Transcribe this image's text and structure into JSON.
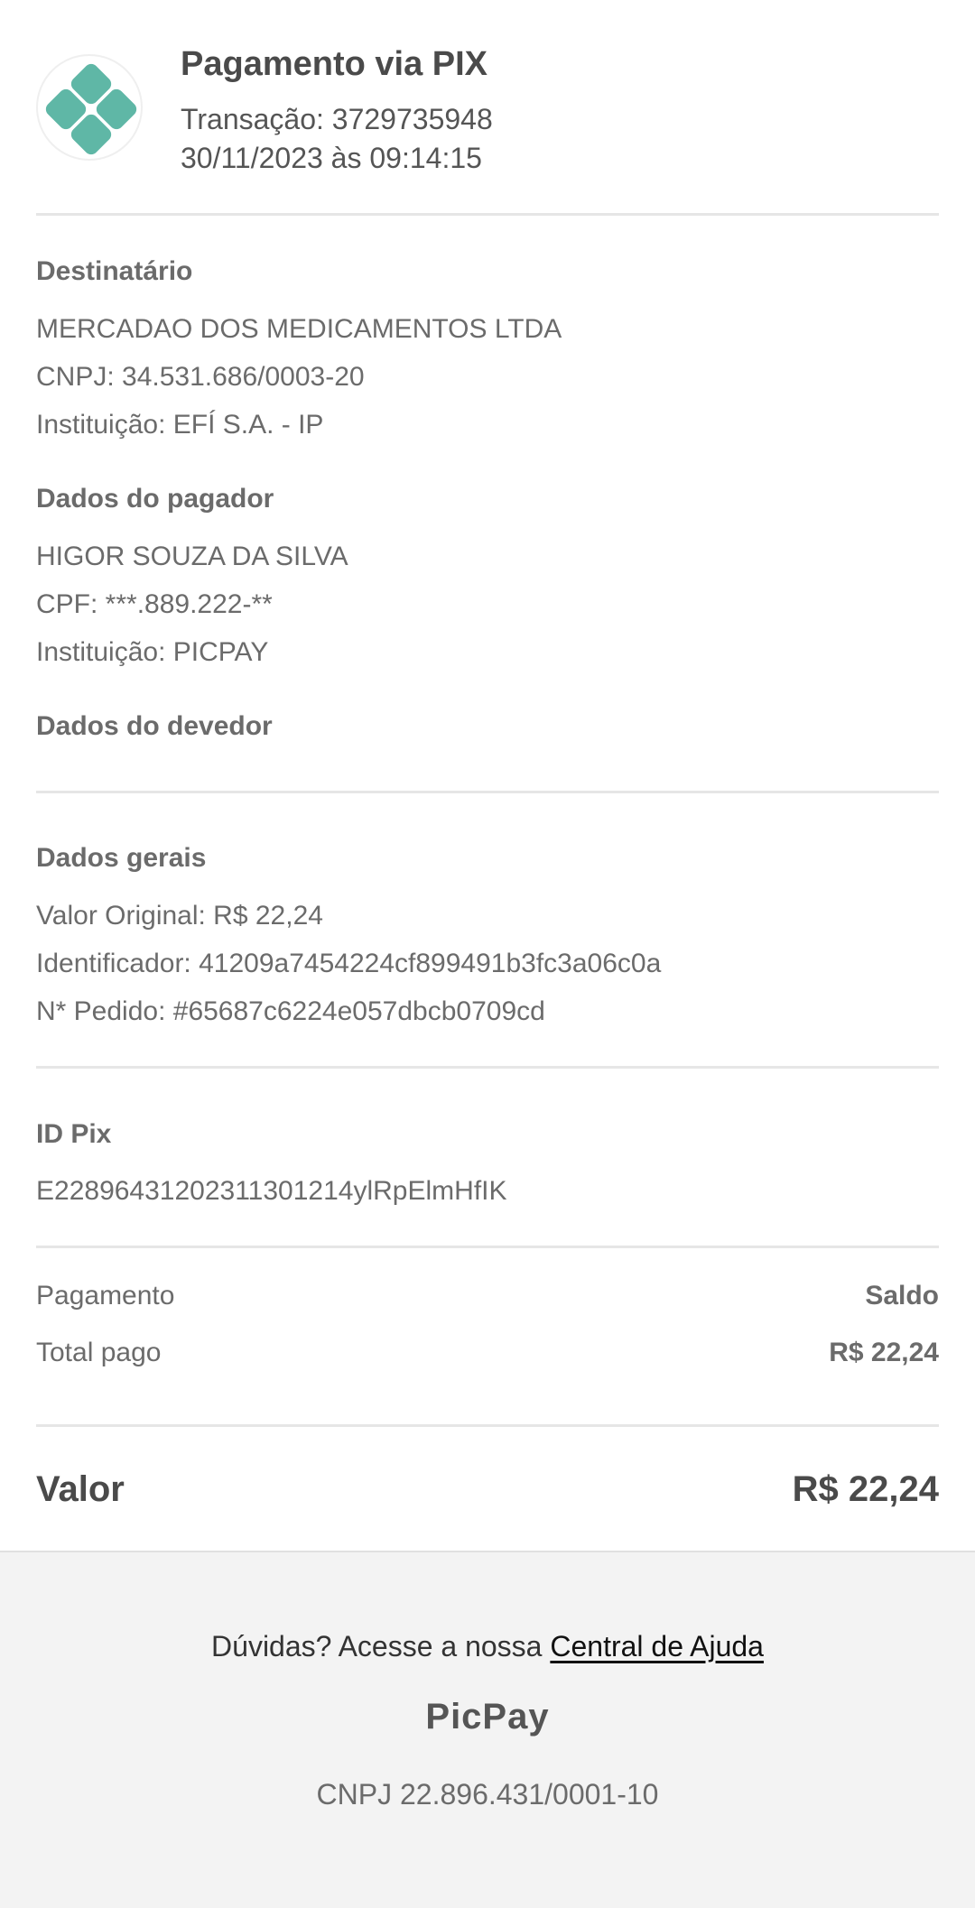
{
  "header": {
    "logo_icon": "pix-logo-icon",
    "title": "Pagamento via PIX",
    "transaction": "Transação: 3729735948",
    "datetime": "30/11/2023 às 09:14:15"
  },
  "recipient": {
    "title": "Destinatário",
    "name": "MERCADAO DOS MEDICAMENTOS LTDA",
    "cnpj": "CNPJ: 34.531.686/0003-20",
    "institution": "Instituição: EFÍ S.A. - IP"
  },
  "payer": {
    "title": "Dados do pagador",
    "name": "HIGOR SOUZA DA SILVA",
    "cpf": "CPF: ***.889.222-**",
    "institution": "Instituição: PICPAY"
  },
  "debtor": {
    "title": "Dados do devedor"
  },
  "general": {
    "title": "Dados gerais",
    "original_value": "Valor Original: R$ 22,24",
    "identifier": "Identificador: 41209a7454224cf899491b3fc3a06c0a",
    "order": "N* Pedido: #65687c6224e057dbcb0709cd"
  },
  "pix_id": {
    "title": "ID Pix",
    "value": "E22896431202311301214ylRpElmHfIK"
  },
  "payment": {
    "method_label": "Pagamento",
    "method_value": "Saldo",
    "total_label": "Total pago",
    "total_value": "R$ 22,24"
  },
  "summary": {
    "label": "Valor",
    "amount": "R$ 22,24"
  },
  "footer": {
    "help_text": "Dúvidas? Acesse a nossa",
    "help_link": "Central de Ajuda",
    "brand": "PicPay",
    "cnpj": "CNPJ 22.896.431/0001-10"
  },
  "colors": {
    "pix_teal": "#5fb7a6",
    "text_dark": "#4a4a4a",
    "text_gray": "#6b6b6b",
    "footer_bg": "#f3f3f3"
  }
}
